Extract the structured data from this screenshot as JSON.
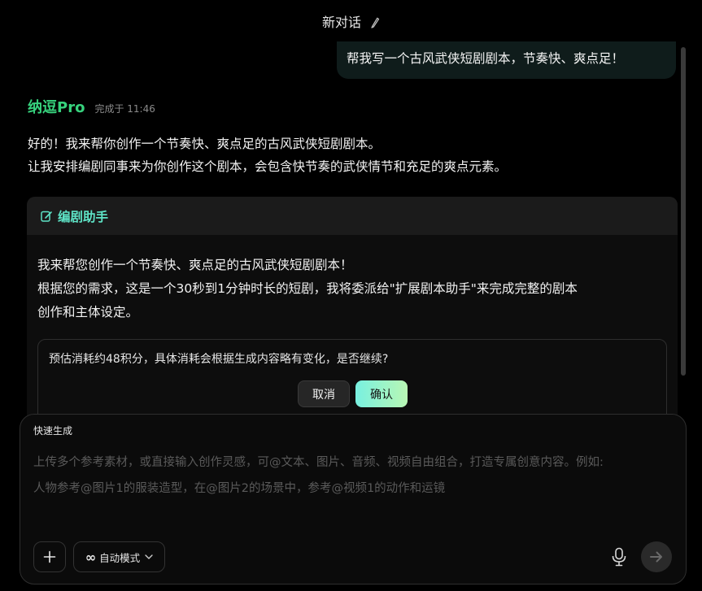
{
  "header": {
    "title": "新对话"
  },
  "user_message": "帮我写一个古风武侠短剧剧本，节奏快、爽点足！",
  "bot": {
    "name": "纳逗Pro",
    "status": "完成于 11:46",
    "lines": [
      "好的！我来帮你创作一个节奏快、爽点足的古风武侠短剧剧本。",
      "让我安排编剧同事来为你创作这个剧本，会包含快节奏的武侠情节和充足的爽点元素。"
    ]
  },
  "card": {
    "title": "编剧助手",
    "lines": [
      "我来帮您创作一个节奏快、爽点足的古风武侠短剧剧本！",
      "根据您的需求，这是一个30秒到1分钟时长的短剧，我将委派给\"扩展剧本助手\"来完成完整的剧本",
      "创作和主体设定。"
    ],
    "confirm_text": "预估消耗约48积分，具体消耗会根据生成内容略有变化，是否继续?",
    "cancel_label": "取消",
    "ok_label": "确认"
  },
  "composer": {
    "title": "快速生成",
    "placeholder_lines": [
      "上传多个参考素材，或直接输入创作灵感，可@文本、图片、音频、视频自由组合，打造专属创意内容。例如:",
      "人物参考@图片1的服装造型，在@图片2的场景中，参考@视频1的动作和运镜"
    ],
    "mode_label": "自动模式",
    "mode_icon": "∞"
  },
  "colors": {
    "accent": "#37d27d",
    "card_title": "#5ee3c6",
    "confirm_gradient": [
      "#78f0e0",
      "#b9f7b4"
    ]
  }
}
